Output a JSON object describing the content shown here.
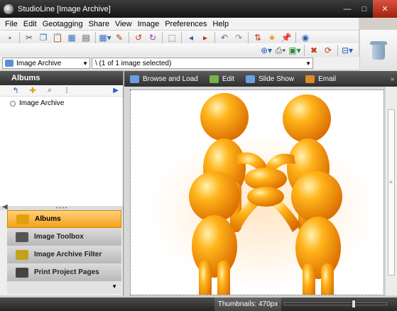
{
  "window": {
    "title": "StudioLine [Image Archive]",
    "minimize": "—",
    "maximize": "□",
    "close": "✕"
  },
  "menu": [
    "File",
    "Edit",
    "Geotagging",
    "Share",
    "View",
    "Image",
    "Preferences",
    "Help"
  ],
  "toolbar_row1": [
    {
      "name": "blank-tool-icon",
      "glyph": "▪",
      "color": "#888"
    },
    {
      "name": "cut-icon",
      "glyph": "✂",
      "color": "#555"
    },
    {
      "name": "copy-icon",
      "glyph": "❐",
      "color": "#3a6fb5"
    },
    {
      "name": "paste-icon",
      "glyph": "📋",
      "color": "#b84a2a"
    },
    {
      "name": "grid-view-icon",
      "glyph": "▦",
      "color": "#3a6fb5"
    },
    {
      "name": "image-strip-icon",
      "glyph": "▤",
      "color": "#555"
    },
    {
      "name": "thumbnail-menu-icon",
      "glyph": "▦▾",
      "color": "#3a6fb5"
    },
    {
      "name": "pencil-icon",
      "glyph": "✎",
      "color": "#c23a1a"
    },
    {
      "name": "rotate-left-icon",
      "glyph": "↺",
      "color": "#c23a1a"
    },
    {
      "name": "rotate-right-icon",
      "glyph": "↻",
      "color": "#9a3ab5"
    },
    {
      "name": "select-all-icon",
      "glyph": "⬚",
      "color": "#555"
    },
    {
      "name": "arrow-left-icon",
      "glyph": "◂",
      "color": "#2a5fb5"
    },
    {
      "name": "arrow-right-icon",
      "glyph": "▸",
      "color": "#c23a1a"
    },
    {
      "name": "undo-icon",
      "glyph": "↶",
      "color": "#3a6fb5"
    },
    {
      "name": "redo-icon",
      "glyph": "↷",
      "color": "#888"
    },
    {
      "name": "sort-icon",
      "glyph": "⇅",
      "color": "#c23a1a"
    },
    {
      "name": "rating-icon",
      "glyph": "★",
      "color": "#e0a010"
    },
    {
      "name": "pin-icon",
      "glyph": "📌",
      "color": "#c23a1a"
    },
    {
      "name": "search-globe-icon",
      "glyph": "◉",
      "color": "#2a5fb5"
    }
  ],
  "toolbar_row2": [
    {
      "name": "import-icon",
      "glyph": "⊕▾",
      "color": "#2a5fb5"
    },
    {
      "name": "print-icon",
      "glyph": "⎙▾",
      "color": "#555"
    },
    {
      "name": "export-icon",
      "glyph": "▣▾",
      "color": "#2a8a3a"
    },
    {
      "name": "delete-icon",
      "glyph": "✖",
      "color": "#c23a1a"
    },
    {
      "name": "refresh-icon",
      "glyph": "⟳",
      "color": "#c23a1a"
    },
    {
      "name": "layout-icon",
      "glyph": "⊟▾",
      "color": "#2a5fb5"
    }
  ],
  "location": {
    "archive_selector": "Image Archive",
    "path": "\\ (1 of 1 image selected)"
  },
  "left_panel": {
    "header": "Albums",
    "tree_tools": [
      {
        "name": "folder-up-icon",
        "glyph": "↰",
        "color": "#2a5fb5"
      },
      {
        "name": "new-folder-icon",
        "glyph": "✚",
        "color": "#e0a010"
      },
      {
        "name": "search-icon",
        "glyph": "⌕",
        "color": "#2a5fb5"
      },
      {
        "name": "tree-view-icon",
        "glyph": "⁞",
        "color": "#555"
      }
    ],
    "tree_root": "Image Archive",
    "panels": [
      {
        "label": "Albums",
        "active": true,
        "icon": "folder-icon",
        "color": "#e0a010"
      },
      {
        "label": "Image Toolbox",
        "active": false,
        "icon": "toolbox-icon",
        "color": "#555"
      },
      {
        "label": "Image Archive Filter",
        "active": false,
        "icon": "filter-icon",
        "color": "#c2a21a"
      },
      {
        "label": "Print Project Pages",
        "active": false,
        "icon": "print-pages-icon",
        "color": "#444"
      }
    ]
  },
  "right_toolbar": [
    {
      "label": "Browse and Load",
      "icon": "browse-load-icon",
      "color": "#6aa0e0"
    },
    {
      "label": "Edit",
      "icon": "edit-icon",
      "color": "#7ab04a"
    },
    {
      "label": "Slide Show",
      "icon": "slideshow-icon",
      "color": "#6aa0e0"
    },
    {
      "label": "Email",
      "icon": "email-icon",
      "color": "#e08a2a"
    }
  ],
  "status": {
    "thumbnails": "Thumbnails: 470px",
    "slider_fraction": 0.68
  },
  "colors": {
    "accent_orange": "#f5a21a",
    "figure_orange": "#ff9500"
  }
}
